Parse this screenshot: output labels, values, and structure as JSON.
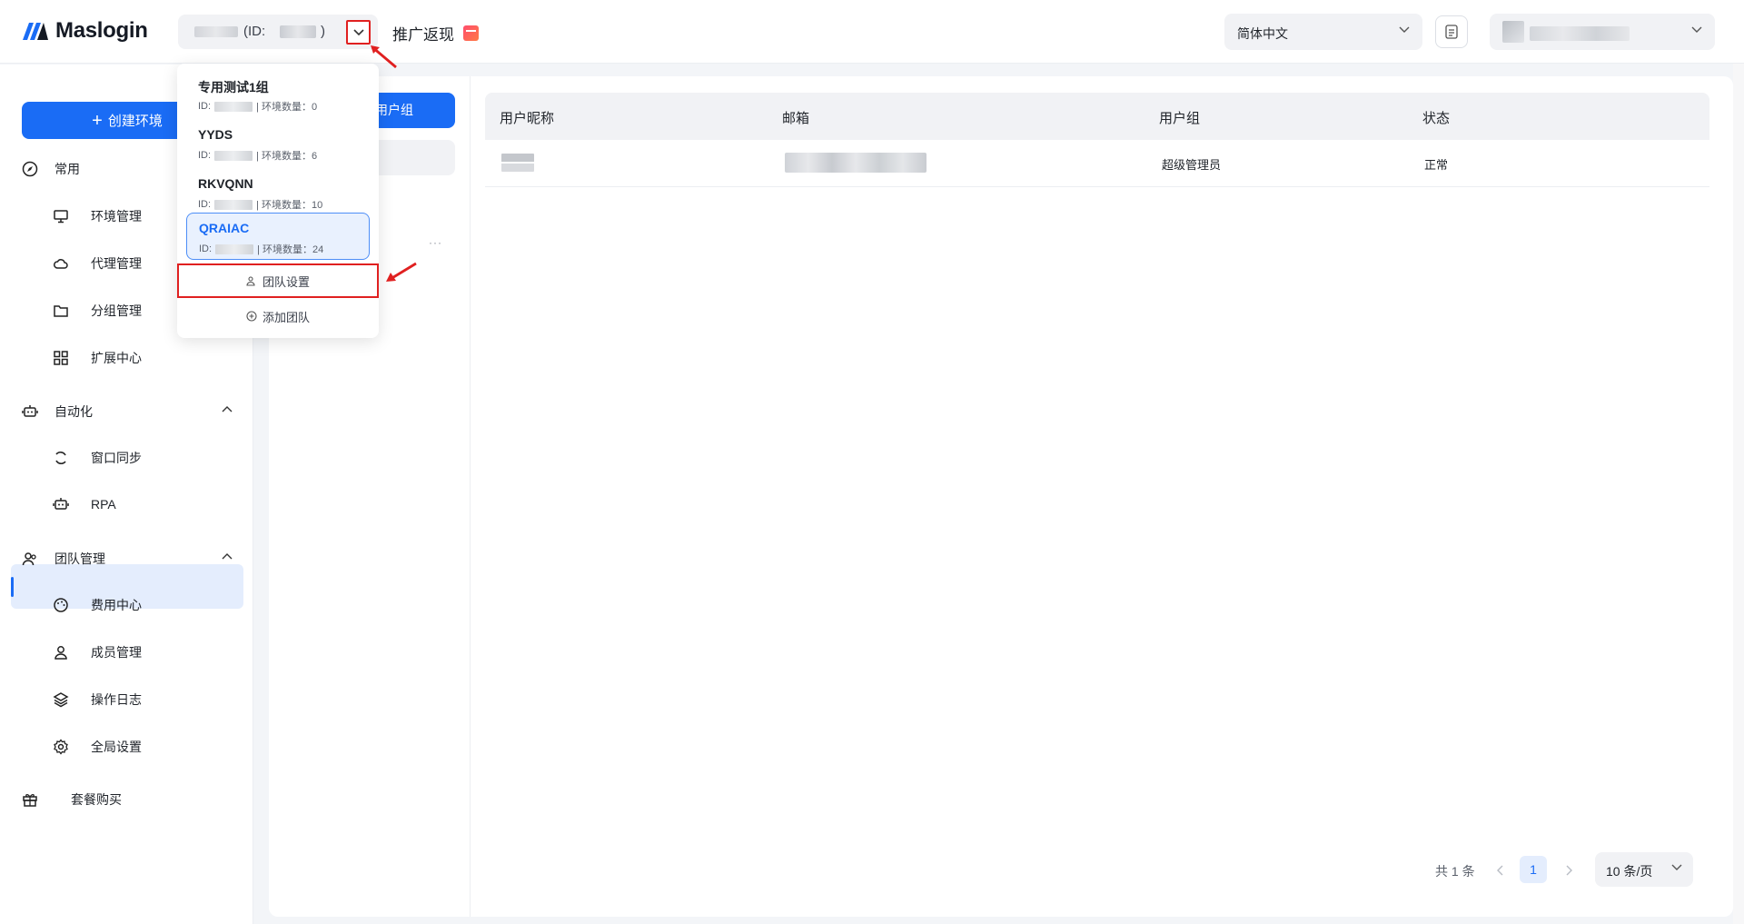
{
  "header": {
    "logo_text": "Maslogin",
    "team_selector": {
      "id_open": "(ID:",
      "id_close": ")"
    },
    "promo_label": "推广返现",
    "language": "简体中文"
  },
  "sidebar": {
    "create_button": "创建环境",
    "groups": {
      "common": "常用",
      "automation": "自动化",
      "team": "团队管理",
      "package": "套餐购买"
    },
    "items": {
      "env": "环境管理",
      "proxy": "代理管理",
      "group": "分组管理",
      "extension": "扩展中心",
      "window_sync": "窗口同步",
      "rpa": "RPA",
      "billing": "费用中心",
      "members": "成员管理",
      "oplog": "操作日志",
      "settings": "全局设置"
    }
  },
  "content": {
    "group_button": "用户组",
    "table": {
      "headers": [
        "用户昵称",
        "邮箱",
        "用户组",
        "状态"
      ],
      "rows": [
        {
          "group": "超级管理员",
          "status": "正常"
        }
      ]
    },
    "pager": {
      "total": "共 1 条",
      "page": "1",
      "size": "10 条/页"
    }
  },
  "team_dropdown": {
    "teams": [
      {
        "name": "专用测试1组",
        "id_label": "ID:",
        "env_count": "| 环境数量：0"
      },
      {
        "name": "YYDS",
        "id_label": "ID:",
        "env_count": "| 环境数量：6"
      },
      {
        "name": "RKVQNN",
        "id_label": "ID:",
        "env_count": "| 环境数量：10"
      },
      {
        "name": "QRAIAC",
        "id_label": "ID:",
        "env_count": "| 环境数量：24"
      }
    ],
    "team_settings": "团队设置",
    "add_team": "添加团队"
  },
  "colors": {
    "accent": "#1a6cf5",
    "highlight_red": "#e02020"
  }
}
